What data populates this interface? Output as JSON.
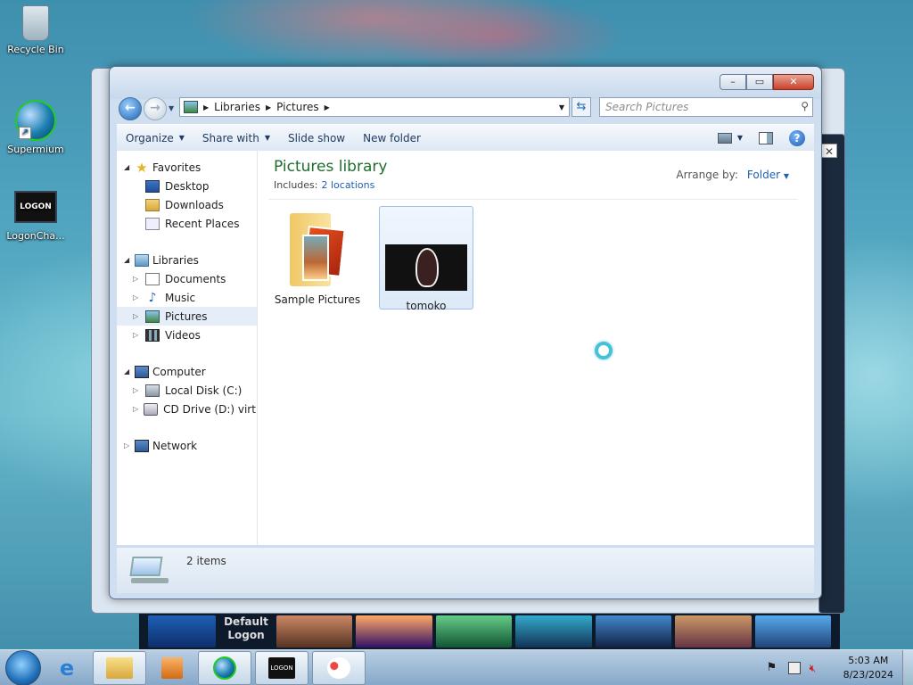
{
  "desktop": {
    "icons": [
      {
        "label": "Recycle Bin"
      },
      {
        "label": "Supermium"
      },
      {
        "label": "LogonCha...",
        "tile_text": "LOGON"
      }
    ]
  },
  "background_window": {
    "thumbnail_label": "Default Logon"
  },
  "window": {
    "caption": {
      "minimize": "▭",
      "maximize": "▭",
      "close": "✕"
    },
    "address": {
      "crumbs": [
        "Libraries",
        "Pictures"
      ]
    },
    "search": {
      "placeholder": "Search Pictures"
    },
    "toolbar": {
      "organize": "Organize",
      "share_with": "Share with",
      "slide_show": "Slide show",
      "new_folder": "New folder",
      "help": "?"
    },
    "nav": {
      "favorites": {
        "label": "Favorites",
        "items": [
          "Desktop",
          "Downloads",
          "Recent Places"
        ]
      },
      "libraries": {
        "label": "Libraries",
        "items": [
          "Documents",
          "Music",
          "Pictures",
          "Videos"
        ]
      },
      "computer": {
        "label": "Computer",
        "items": [
          "Local Disk (C:)",
          "CD Drive (D:) virtio-w"
        ]
      },
      "network": {
        "label": "Network"
      }
    },
    "library": {
      "title": "Pictures library",
      "includes_label": "Includes:",
      "includes_link": "2 locations",
      "arrange_label": "Arrange by:",
      "arrange_value": "Folder"
    },
    "files": [
      {
        "name": "Sample Pictures"
      },
      {
        "name": "tomoko"
      }
    ],
    "details": {
      "count": "2 items"
    }
  },
  "taskbar": {
    "time": "5:03 AM",
    "date": "8/23/2024",
    "logon_tile": "LOGON"
  },
  "colors": {
    "accent_link": "#1f5fb5",
    "library_title": "#1e6e2e",
    "selection": "#e5eef8"
  }
}
